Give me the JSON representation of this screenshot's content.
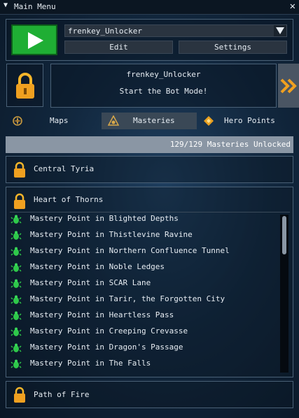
{
  "window": {
    "title": "Main Menu"
  },
  "profile": {
    "selected": "frenkey_Unlocker",
    "edit_label": "Edit",
    "settings_label": "Settings"
  },
  "status": {
    "name": "frenkey_Unlocker",
    "message": "Start the Bot Mode!"
  },
  "tabs": [
    {
      "label": "Maps",
      "active": false,
      "icon": "compass-icon"
    },
    {
      "label": "Masteries",
      "active": true,
      "icon": "mastery-icon"
    },
    {
      "label": "Hero Points",
      "active": false,
      "icon": "hero-point-icon"
    }
  ],
  "progress": {
    "text": "129/129 Masteries Unlocked",
    "value": 1.0
  },
  "categories": [
    {
      "name": "Central Tyria"
    },
    {
      "name": "Heart of Thorns"
    },
    {
      "name": "Path of Fire"
    }
  ],
  "items": [
    "Mastery Point in Blighted Depths",
    "Mastery Point in Thistlevine Ravine",
    "Mastery Point in Northern Confluence Tunnel",
    "Mastery Point in Noble Ledges",
    "Mastery Point in SCAR Lane",
    "Mastery Point in Tarir, the Forgotten City",
    "Mastery Point in Heartless Pass",
    "Mastery Point in Creeping Crevasse",
    "Mastery Point in Dragon's Passage",
    "Mastery Point in The Falls"
  ],
  "colors": {
    "play": "#1fae34",
    "lock": "#f0a020",
    "bug": "#2ec84a",
    "accent": "#f0b020"
  }
}
